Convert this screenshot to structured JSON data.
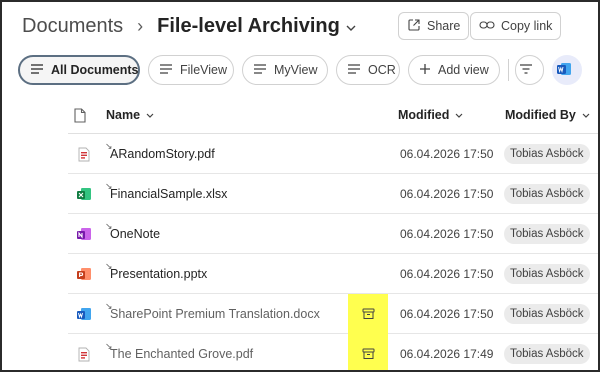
{
  "header": {
    "breadcrumb_root": "Documents",
    "separator": "›",
    "title": "File-level Archiving",
    "share_label": "Share",
    "copy_link_label": "Copy link"
  },
  "views": {
    "items": [
      {
        "label": "All Documents",
        "active": true
      },
      {
        "label": "FileView",
        "active": false
      },
      {
        "label": "MyView",
        "active": false
      },
      {
        "label": "OCR",
        "active": false
      }
    ],
    "add_view_label": "Add view"
  },
  "table": {
    "columns": {
      "name": "Name",
      "modified": "Modified",
      "modified_by": "Modified By"
    },
    "rows": [
      {
        "name": "ARandomStory.pdf",
        "type": "pdf",
        "modified": "06.04.2026 17:50",
        "modified_by": "Tobias Asböck",
        "archived": false
      },
      {
        "name": "FinancialSample.xlsx",
        "type": "excel",
        "modified": "06.04.2026 17:50",
        "modified_by": "Tobias Asböck",
        "archived": false
      },
      {
        "name": "OneNote",
        "type": "onenote",
        "modified": "06.04.2026 17:50",
        "modified_by": "Tobias Asböck",
        "archived": false
      },
      {
        "name": "Presentation.pptx",
        "type": "powerpoint",
        "modified": "06.04.2026 17:50",
        "modified_by": "Tobias Asböck",
        "archived": false
      },
      {
        "name": "SharePoint Premium Translation.docx",
        "type": "word",
        "modified": "06.04.2026 17:50",
        "modified_by": "Tobias Asböck",
        "archived": true
      },
      {
        "name": "The Enchanted Grove.pdf",
        "type": "pdf",
        "modified": "06.04.2026 17:49",
        "modified_by": "Tobias Asböck",
        "archived": true
      }
    ]
  },
  "colors": {
    "highlight": "#ffff4f",
    "pdf": "#d13438",
    "excel": "#107c41",
    "onenote": "#7719aa",
    "powerpoint": "#c43e1c",
    "word": "#185abd"
  }
}
